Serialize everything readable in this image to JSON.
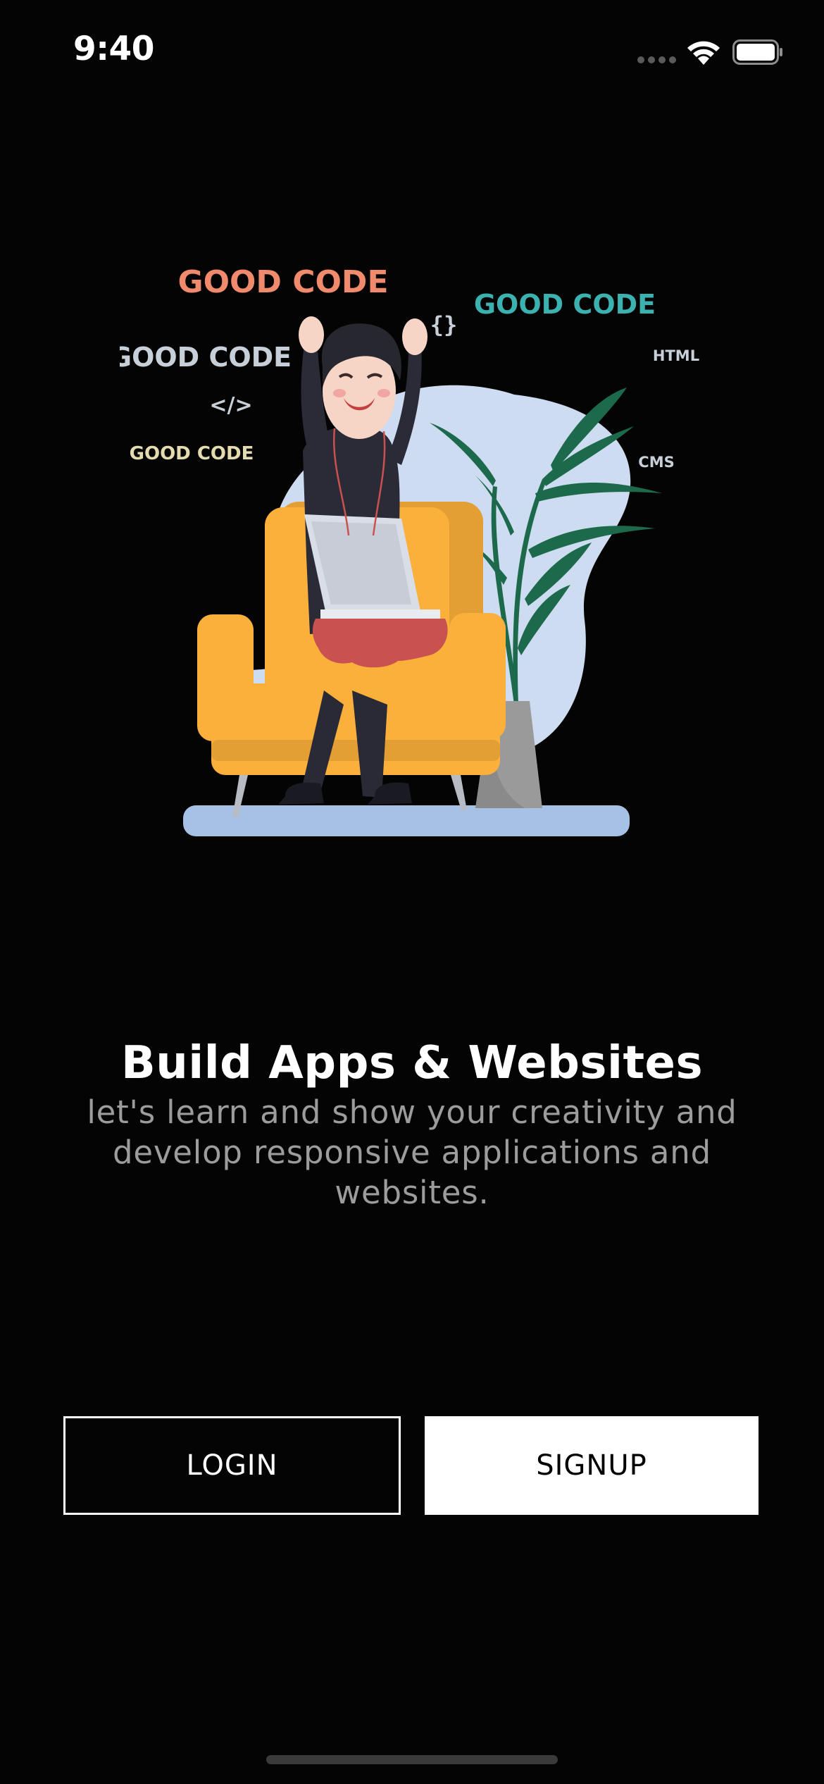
{
  "status_bar": {
    "time": "9:40"
  },
  "illustration": {
    "labels": {
      "good_code_top": "GOOD CODE",
      "good_code_right": "GOOD CODE",
      "good_code_left": "GOOD CODE",
      "good_code_small": "GOOD CODE",
      "braces": "{}",
      "tag": "</>",
      "html": "HTML",
      "cms": "CMS"
    },
    "colors": {
      "coral": "#f08a6c",
      "teal": "#3cb2b0",
      "grey_blue": "#c7cfd9",
      "cream": "#e4dcae",
      "chair": "#fbb03b",
      "blob": "#cddcf0",
      "plant": "#1c6a4b"
    }
  },
  "onboarding": {
    "title": "Build Apps & Websites",
    "description": "let's learn and show your creativity and develop responsive applications and websites."
  },
  "actions": {
    "login_label": "LOGIN",
    "signup_label": "SIGNUP"
  }
}
